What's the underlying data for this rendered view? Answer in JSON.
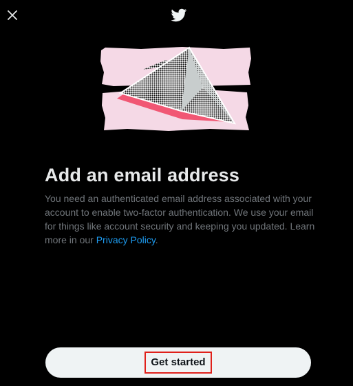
{
  "header": {
    "close_icon": "close-icon",
    "logo_icon": "twitter-bird-icon"
  },
  "illustration": {
    "icon": "paper-airplane-illustration"
  },
  "content": {
    "title": "Add an email address",
    "description": "You need an authenticated email address associated with your account to enable two-factor authentication. We use your email for things like account security and keeping you updated. Learn more in our ",
    "privacy_link": "Privacy Policy",
    "description_end": "."
  },
  "actions": {
    "get_started_label": "Get started"
  },
  "colors": {
    "background": "#000000",
    "title": "#e7e9ea",
    "body_text": "#71767b",
    "link": "#1d9bf0",
    "button_bg": "#eff3f4",
    "button_text": "#0f1419",
    "highlight_border": "#e0201a",
    "illustration_pink": "#f5d9e6",
    "illustration_red": "#f0506e"
  }
}
